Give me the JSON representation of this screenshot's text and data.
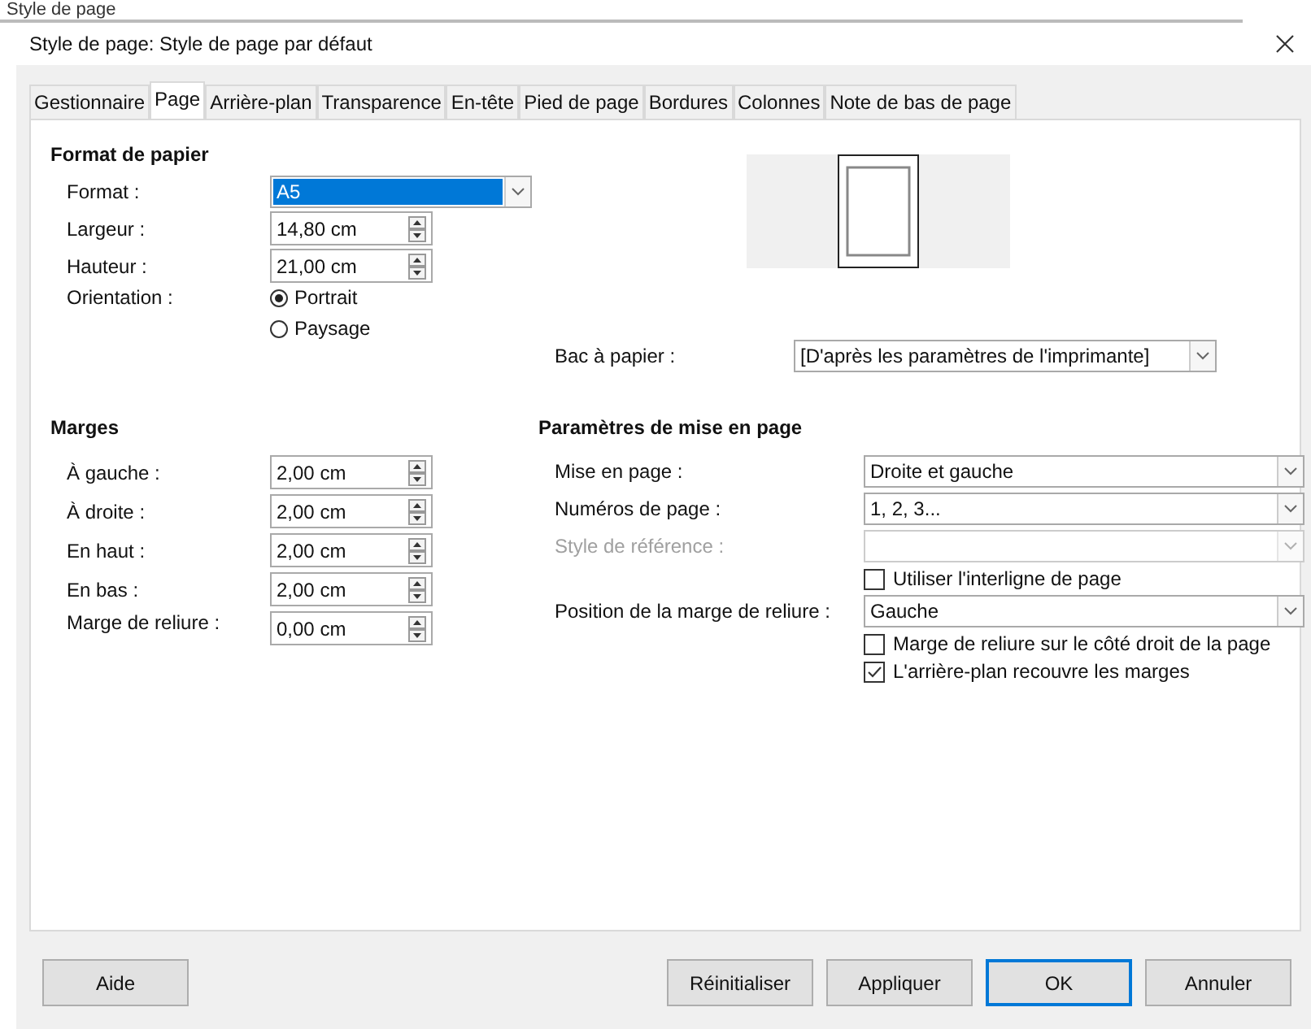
{
  "background_heading": "Style de page",
  "window": {
    "title": "Style de page: Style de page par défaut"
  },
  "tabs": [
    {
      "label": "Gestionnaire",
      "selected": false
    },
    {
      "label": "Page",
      "selected": true
    },
    {
      "label": "Arrière-plan",
      "selected": false
    },
    {
      "label": "Transparence",
      "selected": false
    },
    {
      "label": "En-tête",
      "selected": false
    },
    {
      "label": "Pied de page",
      "selected": false
    },
    {
      "label": "Bordures",
      "selected": false
    },
    {
      "label": "Colonnes",
      "selected": false
    },
    {
      "label": "Note de bas de page",
      "selected": false
    }
  ],
  "paper_format": {
    "heading": "Format de papier",
    "fields": [
      {
        "kind": "dropdown",
        "label": "Format :",
        "value": "A5",
        "highlighted": true
      },
      {
        "kind": "spin",
        "label": "Largeur :",
        "value": "14,80 cm"
      },
      {
        "kind": "spin",
        "label": "Hauteur :",
        "value": "21,00 cm"
      },
      {
        "kind": "radio",
        "label": "Orientation :",
        "options": [
          {
            "label": "Portrait",
            "selected": true
          },
          {
            "label": "Paysage",
            "selected": false
          }
        ]
      }
    ],
    "tray": {
      "label": "Bac à papier :",
      "value": "[D'après les paramètres de l'imprimante]"
    }
  },
  "margins": {
    "heading": "Marges",
    "fields": [
      {
        "label": "À gauche :",
        "value": "2,00 cm"
      },
      {
        "label": "À droite :",
        "value": "2,00 cm"
      },
      {
        "label": "En haut :",
        "value": "2,00 cm"
      },
      {
        "label": "En bas :",
        "value": "2,00 cm"
      },
      {
        "label": "Marge de reliure :",
        "value": "0,00 cm"
      }
    ]
  },
  "layout_settings": {
    "heading": "Paramètres de mise en page",
    "rows": [
      {
        "kind": "dropdown",
        "label": "Mise en page :",
        "value": "Droite et gauche",
        "disabled": false
      },
      {
        "kind": "dropdown",
        "label": "Numéros de page :",
        "value": "1, 2, 3...",
        "disabled": false
      },
      {
        "kind": "dropdown",
        "label": "Style de référence :",
        "disabled": true
      },
      {
        "kind": "checkbox",
        "label": "Utiliser l'interligne de page",
        "checked": false
      },
      {
        "kind": "dropdown",
        "label": "Position de la marge de reliure :",
        "value": "Gauche",
        "disabled": false
      },
      {
        "kind": "checkbox",
        "label": "Marge de reliure sur le côté droit de la page",
        "checked": false
      },
      {
        "kind": "checkbox",
        "label": "L'arrière-plan recouvre les marges",
        "checked": true
      }
    ]
  },
  "buttons": [
    {
      "label": "Aide",
      "default": false
    },
    {
      "label": "Réinitialiser",
      "default": false
    },
    {
      "label": "Appliquer",
      "default": false
    },
    {
      "label": "OK",
      "default": true
    },
    {
      "label": "Annuler",
      "default": false
    }
  ]
}
